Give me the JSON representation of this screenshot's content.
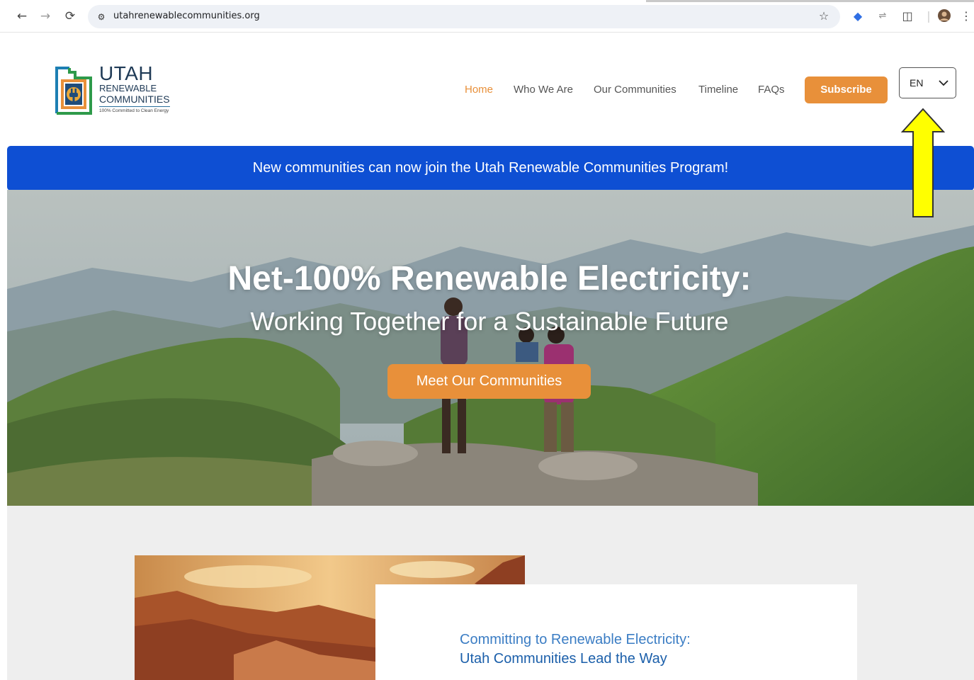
{
  "browser": {
    "url": "utahrenewablecommunities.org"
  },
  "header": {
    "logo": {
      "title": "UTAH",
      "line1": "RENEWABLE",
      "line2": "COMMUNITIES",
      "tagline": "100% Committed to Clean Energy"
    },
    "nav": [
      {
        "label": "Home",
        "active": true
      },
      {
        "label": "Who We Are",
        "active": false
      },
      {
        "label": "Our Communities",
        "active": false
      },
      {
        "label": "Timeline",
        "active": false
      },
      {
        "label": "FAQs",
        "active": false
      }
    ],
    "subscribe_label": "Subscribe",
    "language": "EN"
  },
  "banner": {
    "text": "New communities can now join the Utah Renewable Communities Program!"
  },
  "hero": {
    "title": "Net-100% Renewable Electricity:",
    "subtitle": "Working Together for a Sustainable Future",
    "cta_label": "Meet Our Communities"
  },
  "section": {
    "card_line1": "Committing to Renewable Electricity:",
    "card_line2": "Utah Communities Lead the Way"
  },
  "colors": {
    "accent": "#e8903a",
    "banner": "#0e4fd3",
    "annotation_arrow": "#ffff00"
  }
}
